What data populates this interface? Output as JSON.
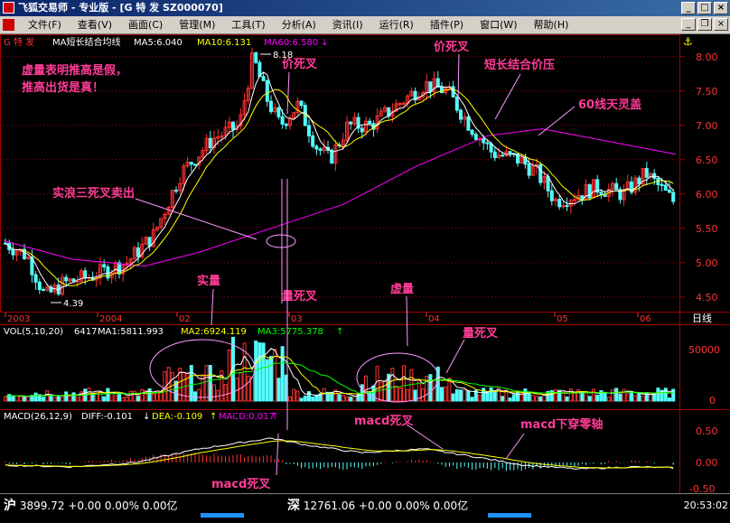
{
  "window": {
    "title": "飞狐交易师 - 专业版 - [G 特  发 SZ000070]",
    "controls": {
      "minimize": "_",
      "maximize": "□",
      "close": "×"
    }
  },
  "menubar": {
    "items": [
      "文件(F)",
      "查看(V)",
      "画面(C)",
      "管理(M)",
      "工具(T)",
      "分析(A)",
      "资讯(I)",
      "运行(R)",
      "插件(P)",
      "窗口(W)",
      "帮助(H)"
    ],
    "mdi_controls": {
      "minimize": "_",
      "restore": "❐",
      "close": "×"
    }
  },
  "price_panel": {
    "stock_name": "G 特  发",
    "indicator_name": "MA短长结合均线",
    "ma5": "MA5:6.040",
    "ma10": "MA10:6.131",
    "ma60": "MA60:6.580",
    "high_label": "8.18",
    "low_label": "4.39",
    "period_label": "日线",
    "ticks": [
      "8.00",
      "7.50",
      "7.00",
      "6.50",
      "6.00",
      "5.50",
      "5.00",
      "4.50"
    ],
    "date_labels": [
      "2003",
      "2004",
      "02",
      "03",
      "04",
      "05",
      "06"
    ]
  },
  "volume_panel": {
    "label": "VOL(5,10,20)",
    "value": "6417",
    "ma1": "MA1:5811.993",
    "ma2": "MA2:6924.119",
    "ma3": "MA3:5775.378",
    "ticks": [
      "50000",
      "0"
    ]
  },
  "macd_panel": {
    "label": "MACD(26,12,9)",
    "diff": "DIFF:-0.101",
    "dea": "DEA:-0.109",
    "macd": "MACD:0.017",
    "ticks": [
      "0.50",
      "0.00",
      "-0.50"
    ]
  },
  "annotations": {
    "false_volume": "虚量表明推高是假，",
    "real_shipping": "推高出货是真！",
    "price_dead_cross_1": "价死叉",
    "price_dead_cross_2": "价死叉",
    "short_long_pressure": "短长结合价压",
    "ma60_cover": "60线天灵盖",
    "real_wave_sell": "实浪三死叉卖出",
    "real_volume": "实量",
    "volume_dead_cross_1": "量死叉",
    "false_volume_2": "虚量",
    "volume_dead_cross_2": "量死叉",
    "macd_dead_cross_1": "macd死叉",
    "macd_dead_cross_2": "macd死叉",
    "macd_below_zero": "macd下穿零轴"
  },
  "statusbar": {
    "sh_label": "沪",
    "sh_values": "3899.72 +0.00 0.00% 0.00亿",
    "sz_label": "深",
    "sz_values": "12761.06 +0.00 0.00% 0.00亿",
    "clock": "20:53:02"
  },
  "colors": {
    "up": "#ff3232",
    "down": "#54fcfc",
    "ma5": "#ffffff",
    "ma10": "#ffff00",
    "ma60": "#ff00ff",
    "annotation": "#ff3c96",
    "grid": "#a00000"
  },
  "chart_data": [
    {
      "type": "candlestick",
      "y_range": [
        4.3,
        8.3
      ],
      "series": [
        {
          "name": "MA5",
          "values": [
            6.04
          ]
        },
        {
          "name": "MA10",
          "values": [
            6.131
          ]
        },
        {
          "name": "MA60",
          "values": [
            6.58
          ]
        }
      ],
      "high": 8.18,
      "low": 4.39
    },
    {
      "type": "bar",
      "series": [
        {
          "name": "VOL",
          "values": [
            6417
          ]
        },
        {
          "name": "MA1",
          "values": [
            5811.993
          ]
        },
        {
          "name": "MA2",
          "values": [
            6924.119
          ]
        },
        {
          "name": "MA3",
          "values": [
            5775.378
          ]
        }
      ]
    },
    {
      "type": "bar",
      "series": [
        {
          "name": "DIFF",
          "values": [
            -0.101
          ]
        },
        {
          "name": "DEA",
          "values": [
            -0.109
          ]
        },
        {
          "name": "MACD",
          "values": [
            0.017
          ]
        }
      ]
    }
  ]
}
